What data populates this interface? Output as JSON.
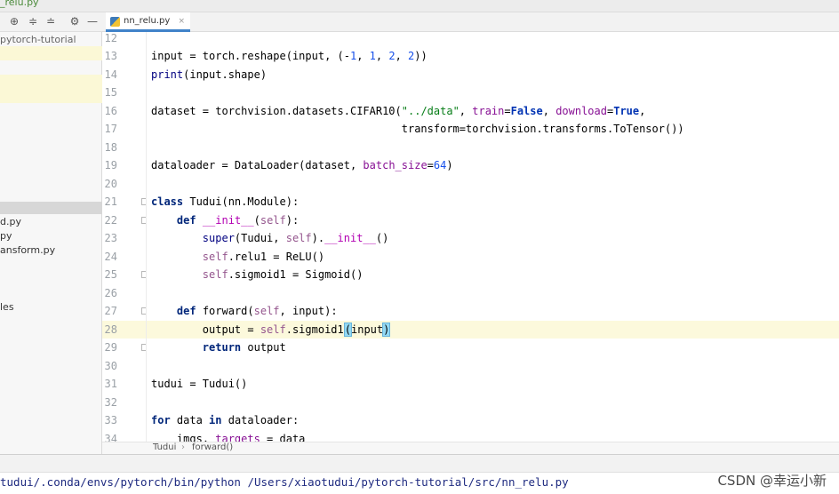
{
  "window": {
    "file_title_fragment": "_relu.py"
  },
  "project_panel": {
    "root_fragment": "pytorch-tutorial",
    "file_fragments": [
      "d.py",
      "py",
      "ansform.py",
      "les"
    ]
  },
  "editor": {
    "active_tab": "nn_relu.py",
    "close_glyph": "×",
    "lines": [
      {
        "n": "12",
        "code": ""
      },
      {
        "n": "13",
        "code": "input = torch.reshape(input, (-1, 1, 2, 2))"
      },
      {
        "n": "14",
        "code": "print(input.shape)"
      },
      {
        "n": "15",
        "code": ""
      },
      {
        "n": "16",
        "code": "dataset = torchvision.datasets.CIFAR10(\"../data\", train=False, download=True,"
      },
      {
        "n": "17",
        "code": "                                       transform=torchvision.transforms.ToTensor())"
      },
      {
        "n": "18",
        "code": ""
      },
      {
        "n": "19",
        "code": "dataloader = DataLoader(dataset, batch_size=64)"
      },
      {
        "n": "20",
        "code": ""
      },
      {
        "n": "21",
        "code": "class Tudui(nn.Module):"
      },
      {
        "n": "22",
        "code": "    def __init__(self):"
      },
      {
        "n": "23",
        "code": "        super(Tudui, self).__init__()"
      },
      {
        "n": "24",
        "code": "        self.relu1 = ReLU()"
      },
      {
        "n": "25",
        "code": "        self.sigmoid1 = Sigmoid()"
      },
      {
        "n": "26",
        "code": ""
      },
      {
        "n": "27",
        "code": "    def forward(self, input):"
      },
      {
        "n": "28",
        "code": "        output = self.sigmoid1(input)"
      },
      {
        "n": "29",
        "code": "        return output"
      },
      {
        "n": "30",
        "code": ""
      },
      {
        "n": "31",
        "code": "tudui = Tudui()"
      },
      {
        "n": "32",
        "code": ""
      },
      {
        "n": "33",
        "code": "for data in dataloader:"
      },
      {
        "n": "34",
        "code": "    imgs, targets = data"
      }
    ],
    "current_line": "28"
  },
  "breadcrumb": {
    "items": [
      "Tudui",
      "forward()"
    ],
    "separator": "›"
  },
  "run_panel": {
    "command": "tudui/.conda/envs/pytorch/bin/python /Users/xiaotudui/pytorch-tutorial/src/nn_relu.py"
  },
  "watermark": "CSDN @幸运小新",
  "colors": {
    "accent": "#4083c9",
    "current_line": "#fcf9dc"
  }
}
